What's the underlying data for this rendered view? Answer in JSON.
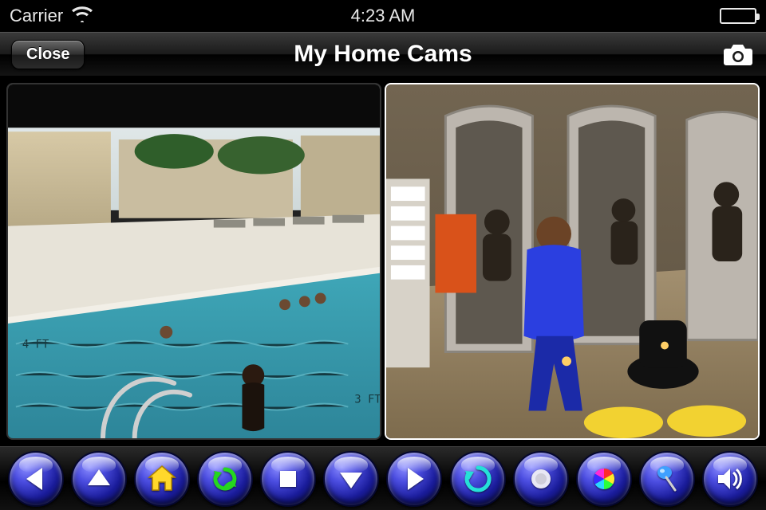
{
  "status": {
    "carrier": "Carrier",
    "time": "4:23 AM"
  },
  "nav": {
    "close_label": "Close",
    "title": "My Home Cams"
  },
  "cams": [
    {
      "name": "pool-cam",
      "overlay": "",
      "selected": false
    },
    {
      "name": "salon-cam",
      "overlay": "",
      "selected": true
    }
  ],
  "toolbar_icons": [
    "left-arrow",
    "up-arrow",
    "home",
    "refresh",
    "stop",
    "down-arrow",
    "right-arrow",
    "reload-swirl",
    "record",
    "color-wheel",
    "pin",
    "speaker"
  ]
}
